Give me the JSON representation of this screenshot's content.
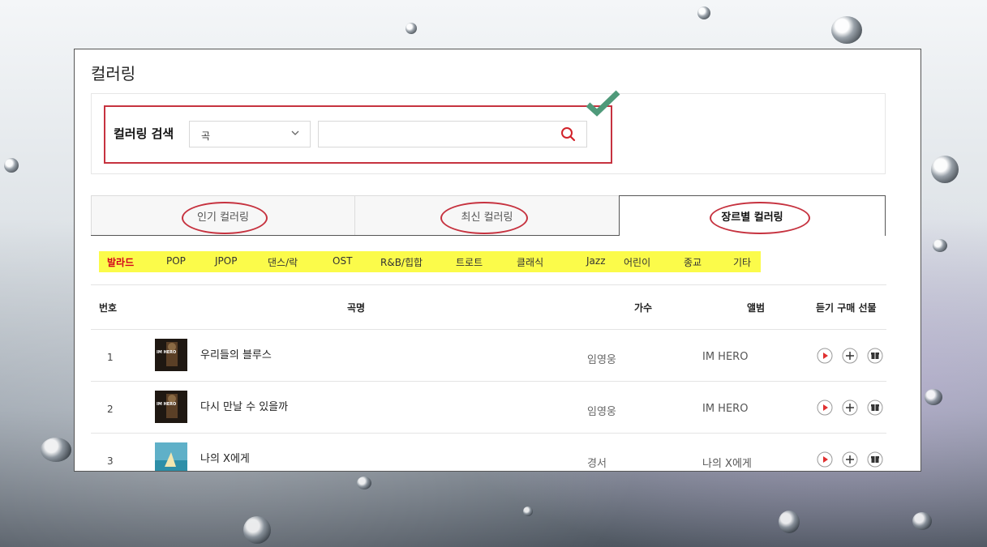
{
  "page": {
    "title": "컬러링"
  },
  "search": {
    "label": "컬러링 검색",
    "select_value": "곡",
    "input_value": "",
    "input_placeholder": ""
  },
  "tabs": [
    {
      "label": "인기 컬러링",
      "active": false
    },
    {
      "label": "최신 컬러링",
      "active": false
    },
    {
      "label": "장르별 컬러링",
      "active": true
    }
  ],
  "genres": [
    "발라드",
    "POP",
    "JPOP",
    "댄스/락",
    "OST",
    "R&B/힙합",
    "트로트",
    "클래식",
    "Jazz",
    "어린이",
    "종교",
    "기타"
  ],
  "genre_active": "발라드",
  "table": {
    "headers": {
      "num": "번호",
      "title": "곡명",
      "artist": "가수",
      "album": "앨범",
      "actions": "듣기 구매 선물"
    },
    "rows": [
      {
        "num": "1",
        "title": "우리들의 블루스",
        "artist": "임영웅",
        "album": "IM HERO",
        "thumb_text": "IM HERO"
      },
      {
        "num": "2",
        "title": "다시 만날 수 있을까",
        "artist": "임영웅",
        "album": "IM HERO",
        "thumb_text": "IM HERO"
      },
      {
        "num": "3",
        "title": "나의 X에게",
        "artist": "경서",
        "album": "나의 X에게",
        "thumb_text": ""
      }
    ]
  },
  "colors": {
    "highlight": "#c6323f",
    "genre_bar": "#fbfb4a",
    "genre_active": "#d2001c",
    "check": "#4f9a7a"
  }
}
